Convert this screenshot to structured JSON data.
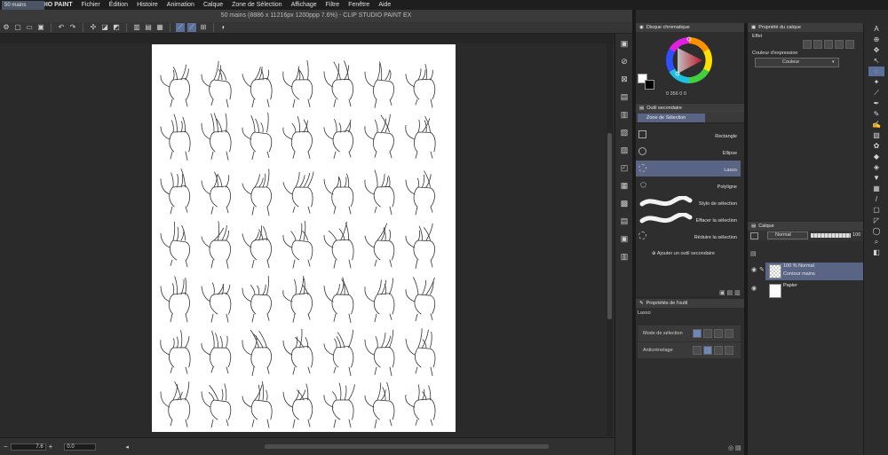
{
  "menubar": {
    "apple": "",
    "app": "CLIP STUDIO PAINT",
    "items": [
      "Fichier",
      "Édition",
      "Histoire",
      "Animation",
      "Calque",
      "Zone de Sélection",
      "Affichage",
      "Filtre",
      "Fenêtre",
      "Aide"
    ]
  },
  "window": {
    "title": "50 mains (8886 x 11216px 1200ppp 7.6%)  - CLIP STUDIO PAINT EX"
  },
  "document": {
    "tab_label": "50 mains"
  },
  "status": {
    "zoom": "7.6",
    "angle": "0.0"
  },
  "color_panel": {
    "title": "Disque chromatique",
    "hsv": "0  356  0  0"
  },
  "layer_property": {
    "title": "Propriété du calque",
    "effect_label": "Effet",
    "expression_label": "Couleur d'expression",
    "expression_value": "Couleur"
  },
  "subtool_panel": {
    "title": "Outil secondaire",
    "group": "Zone de Sélection",
    "items": [
      {
        "label": "Rectangle",
        "icon": "rectangle-icon"
      },
      {
        "label": "Ellipse",
        "icon": "ellipse-icon"
      },
      {
        "label": "Lasso",
        "icon": "lasso-icon"
      },
      {
        "label": "Polyligne",
        "icon": "polyline-icon"
      },
      {
        "label": "Stylo de sélection",
        "icon": "selection-pen-icon"
      },
      {
        "label": "Effacer la sélection",
        "icon": "erase-selection-icon"
      },
      {
        "label": "Réduire la sélection",
        "icon": "shrink-selection-icon"
      }
    ],
    "add_label": "Ajouter un outil secondaire"
  },
  "tool_property": {
    "title": "Propriétés de l'outil",
    "tool_name": "Lasso",
    "selection_mode_label": "Mode de sélection",
    "antialias_label": "Anticrénelage"
  },
  "layer_panel": {
    "title": "Calque",
    "blend_mode": "Normal",
    "opacity": "100",
    "layers": [
      {
        "line1": "100 % Normal",
        "line2": "Contour mains",
        "selected": true
      },
      {
        "line1": "",
        "line2": "Papier",
        "selected": false
      }
    ]
  }
}
